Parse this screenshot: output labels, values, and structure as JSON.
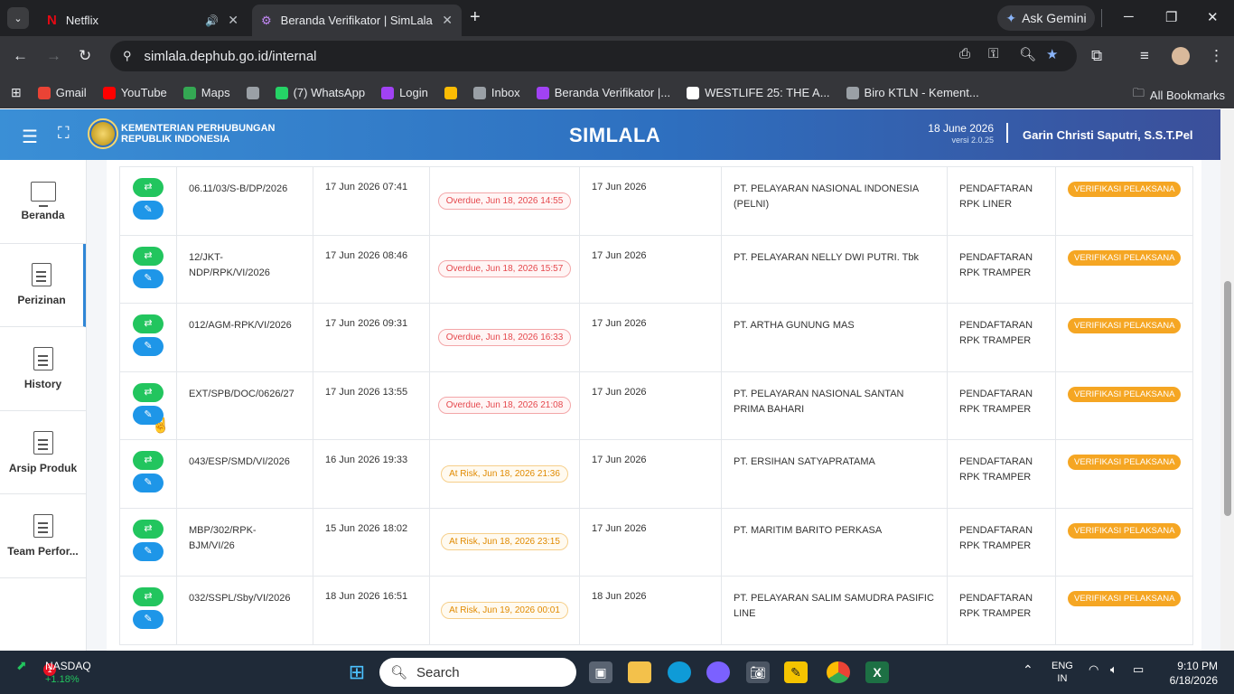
{
  "browser": {
    "tabs": [
      {
        "title": "Netflix",
        "icon": "netflix-icon",
        "audio": true
      },
      {
        "title": "Beranda Verifikator | SimLala",
        "icon": "simlala-icon",
        "active": true
      }
    ],
    "gemini_label": "Ask Gemini",
    "url": "simlala.dephub.go.id/internal",
    "bookmarks": [
      {
        "label": "Gmail",
        "icon": "gmail-icon",
        "color": "#ea4335"
      },
      {
        "label": "YouTube",
        "icon": "youtube-icon",
        "color": "#ff0000"
      },
      {
        "label": "Maps",
        "icon": "maps-icon",
        "color": "#34a853"
      },
      {
        "label": "",
        "icon": "globe-icon",
        "color": "#9aa0a6"
      },
      {
        "label": "(7) WhatsApp",
        "icon": "whatsapp-icon",
        "color": "#25d366"
      },
      {
        "label": "Login",
        "icon": "login-icon",
        "color": "#a142f4"
      },
      {
        "label": "",
        "icon": "pinwheel-icon",
        "color": "#fbbc04"
      },
      {
        "label": "Inbox",
        "icon": "inbox-icon",
        "color": "#9aa0a6"
      },
      {
        "label": "Beranda Verifikator |...",
        "icon": "simlala-icon",
        "color": "#a142f4"
      },
      {
        "label": "WESTLIFE 25: THE A...",
        "icon": "bookmark-l-icon",
        "color": "#ffffff"
      },
      {
        "label": "Biro KTLN - Kement...",
        "icon": "globe-icon",
        "color": "#9aa0a6"
      }
    ],
    "all_bookmarks": "All Bookmarks"
  },
  "app": {
    "org_line1": "KEMENTERIAN PERHUBUNGAN",
    "org_line2": "REPUBLIK INDONESIA",
    "brand": "SIMLALA",
    "date": "18 June 2026",
    "version": "versi 2.0.25",
    "user": "Garin Christi Saputri, S.S.T.Pel"
  },
  "sidebar": {
    "items": [
      {
        "label": "Beranda",
        "icon": "monitor-icon"
      },
      {
        "label": "Perizinan",
        "icon": "document-icon",
        "active": true
      },
      {
        "label": "History",
        "icon": "document-icon"
      },
      {
        "label": "Arsip Produk",
        "icon": "document-icon"
      },
      {
        "label": "Team Perfor...",
        "icon": "document-icon"
      }
    ]
  },
  "table": {
    "rows": [
      {
        "nomor": "06.11/03/S-B/DP/2026",
        "tanggal": "17 Jun 2026 07:41",
        "due": "Overdue, Jun 18, 2026 14:55",
        "due_type": "overdue",
        "tgl": "17 Jun 2026",
        "perusahaan": "PT. PELAYARAN NASIONAL INDONESIA (PELNI)",
        "layanan": "PENDAFTARAN RPK LINER",
        "status": "VERIFIKASI PELAKSANA"
      },
      {
        "nomor": "12/JKT-NDP/RPK/VI/2026",
        "tanggal": "17 Jun 2026 08:46",
        "due": "Overdue, Jun 18, 2026 15:57",
        "due_type": "overdue",
        "tgl": "17 Jun 2026",
        "perusahaan": "PT. PELAYARAN NELLY DWI PUTRI. Tbk",
        "layanan": "PENDAFTARAN RPK TRAMPER",
        "status": "VERIFIKASI PELAKSANA"
      },
      {
        "nomor": "012/AGM-RPK/VI/2026",
        "tanggal": "17 Jun 2026 09:31",
        "due": "Overdue, Jun 18, 2026 16:33",
        "due_type": "overdue",
        "tgl": "17 Jun 2026",
        "perusahaan": "PT. ARTHA GUNUNG MAS",
        "layanan": "PENDAFTARAN RPK TRAMPER",
        "status": "VERIFIKASI PELAKSANA"
      },
      {
        "nomor": "EXT/SPB/DOC/0626/27",
        "tanggal": "17 Jun 2026 13:55",
        "due": "Overdue, Jun 18, 2026 21:08",
        "due_type": "overdue",
        "tgl": "17 Jun 2026",
        "perusahaan": "PT. PELAYARAN NASIONAL SANTAN PRIMA BAHARI",
        "layanan": "PENDAFTARAN RPK TRAMPER",
        "status": "VERIFIKASI PELAKSANA"
      },
      {
        "nomor": "043/ESP/SMD/VI/2026",
        "tanggal": "16 Jun 2026 19:33",
        "due": "At Risk, Jun 18, 2026 21:36",
        "due_type": "risk",
        "tgl": "17 Jun 2026",
        "perusahaan": "PT. ERSIHAN SATYAPRATAMA",
        "layanan": "PENDAFTARAN RPK TRAMPER",
        "status": "VERIFIKASI PELAKSANA"
      },
      {
        "nomor": "MBP/302/RPK-BJM/VI/26",
        "tanggal": "15 Jun 2026 18:02",
        "due": "At Risk, Jun 18, 2026 23:15",
        "due_type": "risk",
        "tgl": "17 Jun 2026",
        "perusahaan": "PT. MARITIM BARITO PERKASA",
        "layanan": "PENDAFTARAN RPK TRAMPER",
        "status": "VERIFIKASI PELAKSANA"
      },
      {
        "nomor": "032/SSPL/Sby/VI/2026",
        "tanggal": "18 Jun 2026 16:51",
        "due": "At Risk, Jun 19, 2026 00:01",
        "due_type": "risk",
        "tgl": "18 Jun 2026",
        "perusahaan": "PT. PELAYARAN SALIM SAMUDRA PASIFIC LINE",
        "layanan": "PENDAFTARAN RPK TRAMPER",
        "status": "VERIFIKASI PELAKSANA"
      }
    ]
  },
  "taskbar": {
    "stock_name": "NASDAQ",
    "stock_change": "+1.18%",
    "stock_badge": "1",
    "search_placeholder": "Search",
    "lang1": "ENG",
    "lang2": "IN",
    "time": "9:10 PM",
    "date": "6/18/2026"
  },
  "colors": {
    "accent": "#2f86d6",
    "overdue": "#e5484d",
    "at_risk": "#e08a00",
    "status_badge": "#f5a623",
    "action_green": "#22c55e",
    "action_blue": "#1e96e8"
  }
}
